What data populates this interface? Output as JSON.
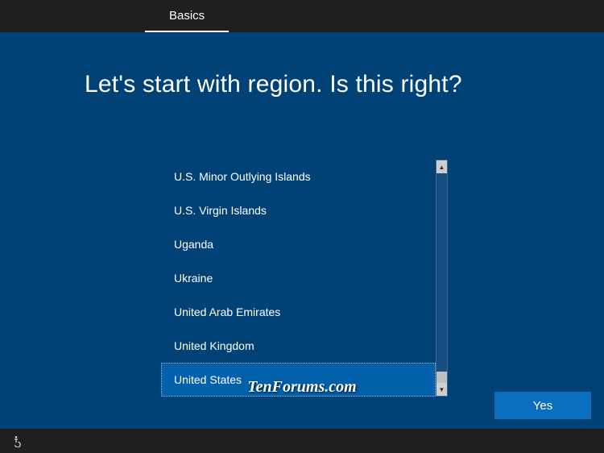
{
  "header": {
    "tab_label": "Basics"
  },
  "main": {
    "heading": "Let's start with region. Is this right?",
    "regions": [
      "U.S. Minor Outlying Islands",
      "U.S. Virgin Islands",
      "Uganda",
      "Ukraine",
      "United Arab Emirates",
      "United Kingdom",
      "United States"
    ],
    "selected_index": 6,
    "yes_label": "Yes"
  },
  "watermark": "TenForums.com"
}
